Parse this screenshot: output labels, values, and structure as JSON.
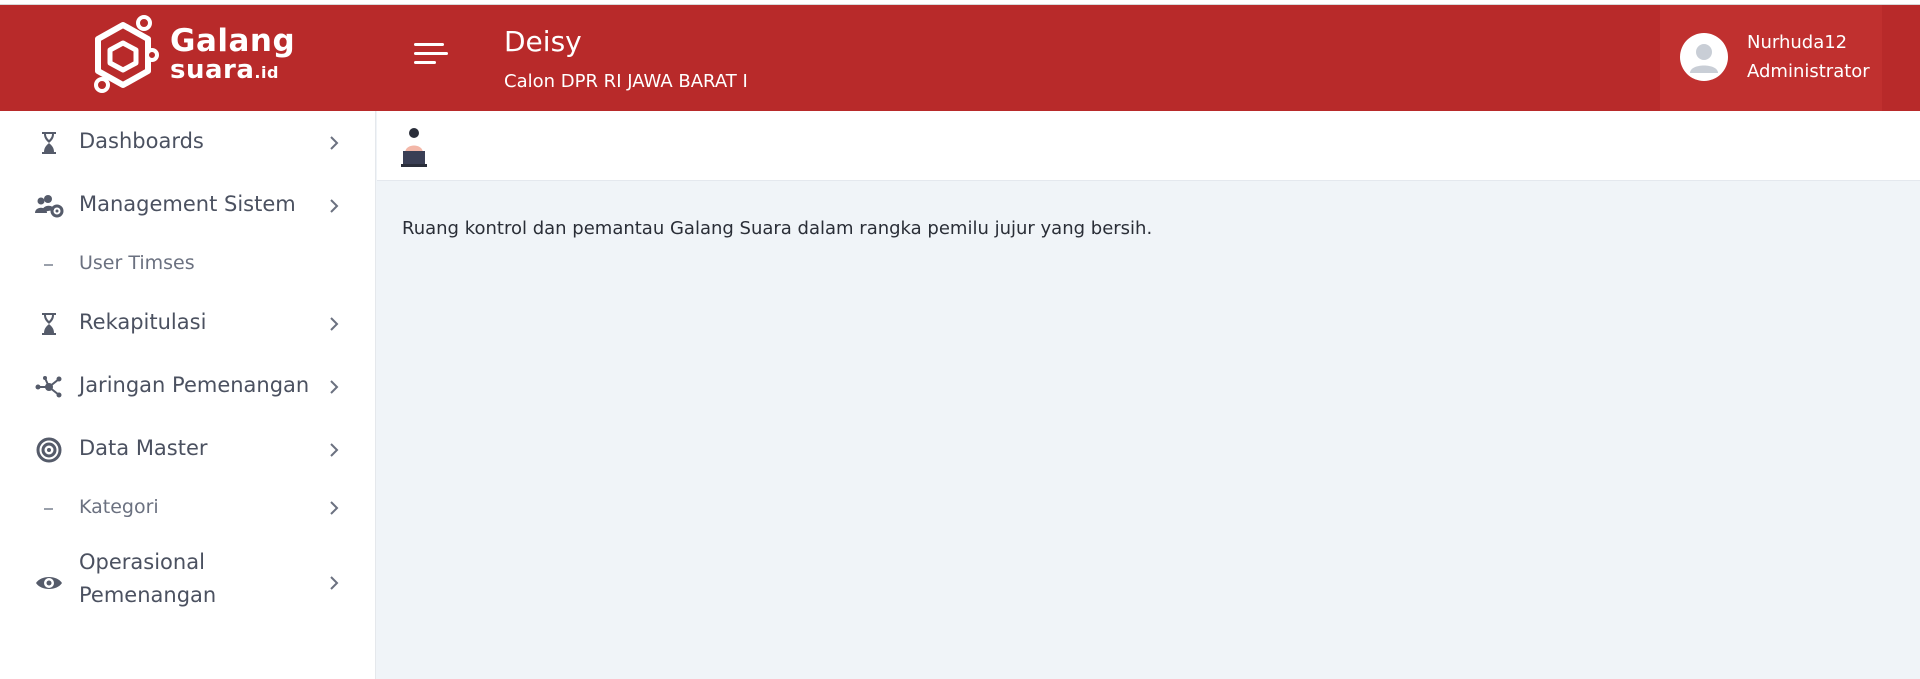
{
  "brand": {
    "name_line1": "Galang",
    "name_line2": "suara",
    "name_tld": ".id"
  },
  "header": {
    "title": "Deisy",
    "subtitle": "Calon DPR RI JAWA BARAT I",
    "menu_icon": "hamburger-icon"
  },
  "user": {
    "name": "Nurhuda12",
    "role": "Administrator",
    "avatar_icon": "user-avatar-icon"
  },
  "sidebar": {
    "items": [
      {
        "label": "Dashboards",
        "icon": "hourglass-icon"
      },
      {
        "label": "Management Sistem",
        "icon": "users-cog-icon"
      },
      {
        "label": "User Timses",
        "icon": "dash-icon"
      },
      {
        "label": "Rekapitulasi",
        "icon": "hourglass-icon"
      },
      {
        "label": "Jaringan Pemenangan",
        "icon": "network-icon"
      },
      {
        "label": "Data Master",
        "icon": "target-icon"
      },
      {
        "label": "Kategori",
        "icon": "dash-icon"
      },
      {
        "label": "Operasional",
        "label2": "Pemenangan",
        "icon": "eye-icon"
      }
    ]
  },
  "main": {
    "description": "Ruang kontrol dan pemantau Galang Suara dalam rangka pemilu jujur yang bersih.",
    "header_icon": "person-laptop-icon"
  },
  "colors": {
    "header_red": "#b82a2a",
    "user_box_red": "#c0302f",
    "sidebar_bg": "#ffffff",
    "content_bg": "#f0f4f8"
  }
}
